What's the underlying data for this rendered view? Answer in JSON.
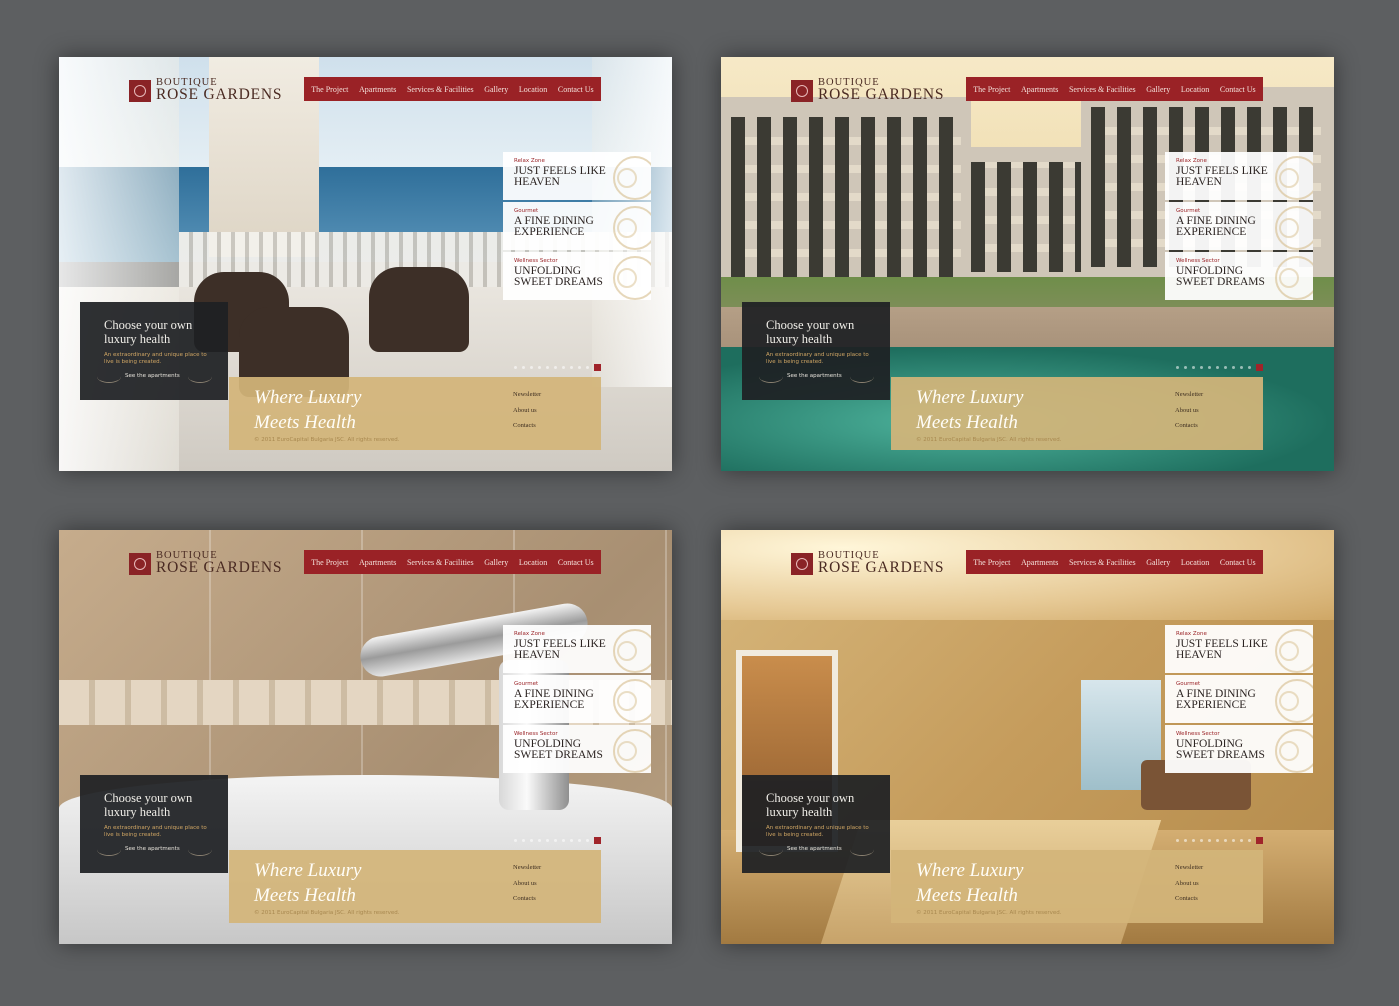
{
  "site": {
    "logo_small": "BOUTIQUE",
    "logo_big": "ROSE GARDENS"
  },
  "nav": [
    "The Project",
    "Apartments",
    "Services & Facilities",
    "Gallery",
    "Location",
    "Contact Us"
  ],
  "features": [
    {
      "category": "Relax Zone",
      "title": "JUST FEELS LIKE HEAVEN"
    },
    {
      "category": "Gourmet",
      "title": "A FINE DINING EXPERIENCE"
    },
    {
      "category": "Wellness Sector",
      "title": "UNFOLDING SWEET DREAMS"
    }
  ],
  "promo": {
    "heading": "Choose your own luxury health",
    "subtext": "An extraordinary and unique place to live is being created.",
    "link": "See the apartments"
  },
  "band": {
    "slogan_line1": "Where Luxury",
    "slogan_line2": "Meets Health",
    "copyright": "© 2011 EuroCapital Bulgaria JSC. All rights reserved.",
    "links": [
      "Newsletter",
      "About us",
      "Contacts"
    ]
  },
  "colors": {
    "nav_red": "#9a2226",
    "band_gold": "#d3b57a",
    "promo_dark": "#1e2023",
    "page_background": "#5d5f61"
  },
  "icons": [
    "logo-emblem-icon",
    "swirl-ornament-icon",
    "ornament-flourish-icon",
    "slide-marker-icon"
  ]
}
